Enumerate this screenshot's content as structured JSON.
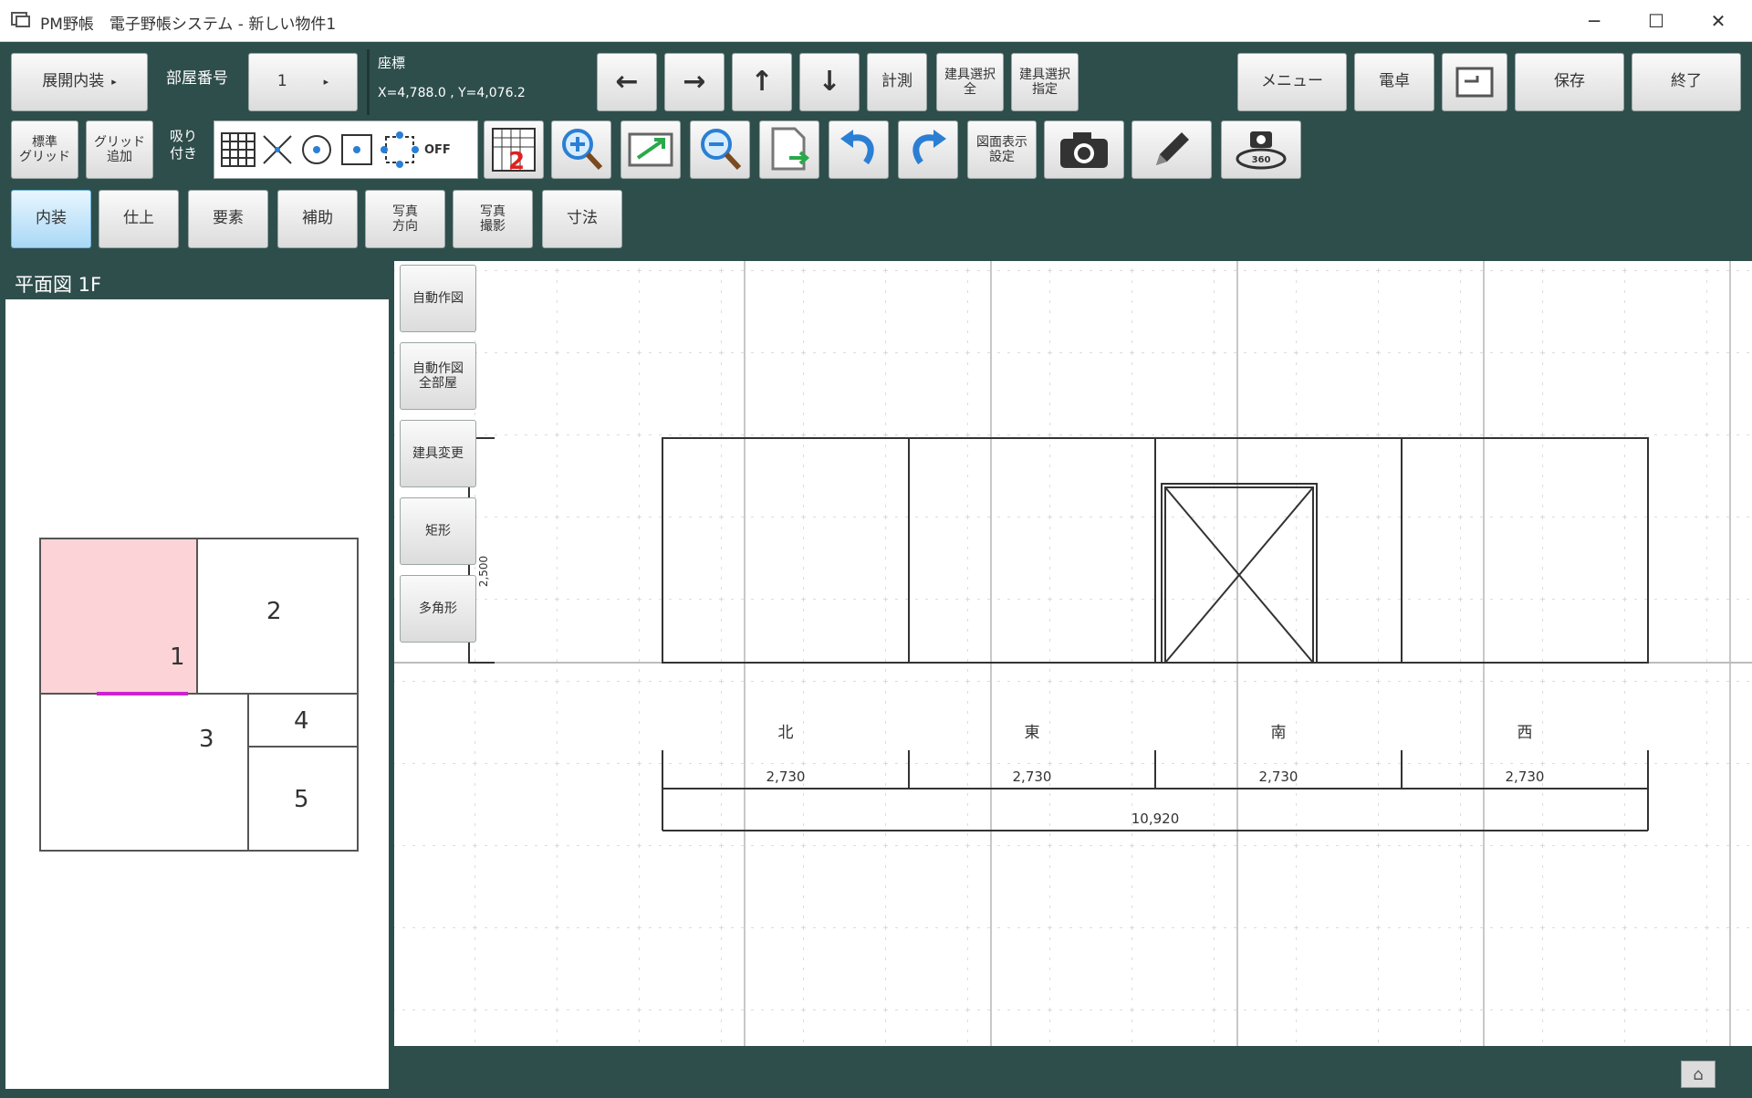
{
  "window": {
    "title": "PM野帳　電子野帳システム - 新しい物件1",
    "minimize": "─",
    "maximize": "☐",
    "close": "✕"
  },
  "toolbar": {
    "mode_select": "展開内装",
    "room_number_label": "部屋番号",
    "room_number_value": "1",
    "coord_label": "座標",
    "coord_value": "X=4,788.0 , Y=4,076.2",
    "arrow_left": "←",
    "arrow_right": "→",
    "arrow_up": "↑",
    "arrow_down": "↓",
    "measure": "計測",
    "fixture_all": "建具選択\n全",
    "fixture_specify": "建具選択\n指定",
    "menu": "メニュー",
    "calculator": "電卓",
    "save": "保存",
    "exit": "終了",
    "standard_grid": "標準\nグリッド",
    "add_grid": "グリッド\n追加",
    "snap_label": "吸り\n付き",
    "snap_off": "OFF",
    "display_settings": "図面表示\n設定",
    "tabs": [
      "内装",
      "仕上",
      "要素",
      "補助",
      "写真\n方向",
      "写真\n撮影",
      "寸法"
    ]
  },
  "left_panel": {
    "header": "平面図 1F",
    "rooms": [
      "1",
      "2",
      "3",
      "4",
      "5"
    ],
    "selected_room": "1"
  },
  "side_tools": [
    "自動作図",
    "自動作図\n全部屋",
    "建具変更",
    "矩形",
    "多角形"
  ],
  "drawing": {
    "height_dim": "2,500",
    "directions": [
      "北",
      "東",
      "南",
      "西"
    ],
    "wall_widths": [
      "2,730",
      "2,730",
      "2,730",
      "2,730"
    ],
    "total_width": "10,920"
  },
  "colors": {
    "chrome": "#2e4e4c",
    "selected_room_fill": "#fcd4d8",
    "selected_edge": "#cc22cc",
    "active_tab": "#a9d8f6"
  }
}
